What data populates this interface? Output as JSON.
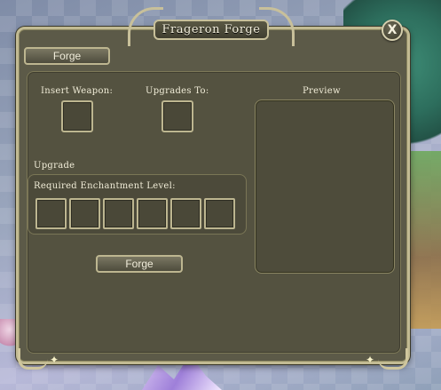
{
  "window": {
    "title": "Frageron Forge",
    "close_glyph": "X"
  },
  "tabs": [
    {
      "label": "Forge"
    }
  ],
  "forge": {
    "insert_weapon_label": "Insert Weapon:",
    "upgrades_to_label": "Upgrades To:",
    "preview_label": "Preview",
    "upgrade_label": "Upgrade",
    "required_enchantment_label": "Required Enchantment Level:",
    "enchantment_slot_count": 6,
    "forge_button_label": "Forge"
  },
  "icons": {
    "close": "close-icon",
    "corner_star": "star-icon"
  },
  "colors": {
    "frame": "#c2bb93",
    "panel": "#545240",
    "text": "#f0ecd7"
  }
}
